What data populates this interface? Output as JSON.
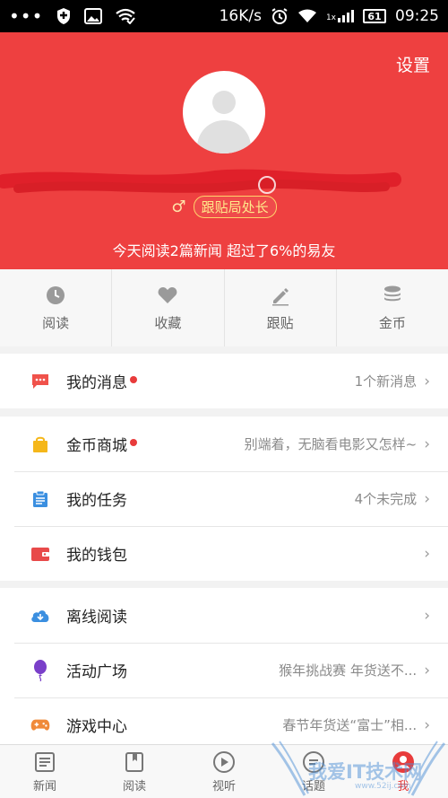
{
  "status_bar": {
    "network_speed": "16K/s",
    "time": "09:25",
    "battery": "61",
    "signal_label": "1x"
  },
  "header": {
    "settings_label": "设置",
    "gender_symbol": "♂",
    "level_badge": "跟贴局处长",
    "tagline": "今天阅读2篇新闻 超过了6%的易友",
    "background_color": "#ee4040"
  },
  "quick_actions": [
    {
      "label": "阅读",
      "icon": "clock-icon"
    },
    {
      "label": "收藏",
      "icon": "heart-icon"
    },
    {
      "label": "跟贴",
      "icon": "pencil-icon"
    },
    {
      "label": "金币",
      "icon": "coins-icon"
    }
  ],
  "group1": [
    {
      "title": "我的消息",
      "dot": true,
      "sub": "1个新消息",
      "icon": "message-icon",
      "color": "#f0524b"
    }
  ],
  "group2": [
    {
      "title": "金币商城",
      "dot": true,
      "sub": "别端着，无脑看电影又怎样~",
      "icon": "shopping-bag-icon",
      "color": "#f5b71a"
    },
    {
      "title": "我的任务",
      "dot": false,
      "sub": "4个未完成",
      "icon": "clipboard-icon",
      "color": "#3b8fe0"
    },
    {
      "title": "我的钱包",
      "dot": false,
      "sub": "",
      "icon": "wallet-icon",
      "color": "#e84a4a"
    }
  ],
  "group3": [
    {
      "title": "离线阅读",
      "dot": false,
      "sub": "",
      "icon": "cloud-download-icon",
      "color": "#3b8fe0"
    },
    {
      "title": "活动广场",
      "dot": false,
      "sub": "猴年挑战赛 年货送不...",
      "icon": "balloon-icon",
      "color": "#7a3fc9"
    },
    {
      "title": "游戏中心",
      "dot": false,
      "sub": "春节年货送“富士”相...",
      "icon": "gamepad-icon",
      "color": "#f08a3a"
    }
  ],
  "tabs": [
    {
      "label": "新闻",
      "icon": "news-icon",
      "active": false
    },
    {
      "label": "阅读",
      "icon": "book-icon",
      "active": false
    },
    {
      "label": "视听",
      "icon": "play-icon",
      "active": false
    },
    {
      "label": "话题",
      "icon": "topic-icon",
      "active": false
    },
    {
      "label": "我",
      "icon": "me-icon",
      "active": true
    }
  ],
  "watermark": {
    "text": "我爱IT技术网",
    "url": "www.52ij.com"
  },
  "colors": {
    "accent": "#e83b3b",
    "chevron": "#9a9a9a"
  }
}
